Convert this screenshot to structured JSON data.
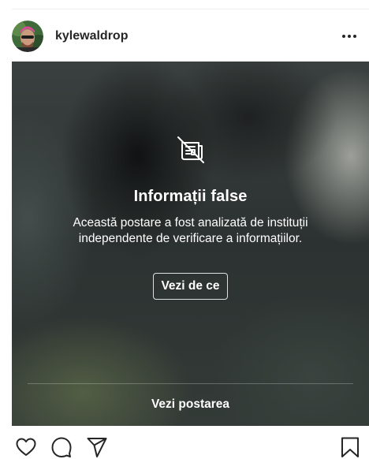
{
  "post": {
    "username": "kylewaldrop",
    "avatar_icon": "profile-photo",
    "more_icon": "more-options-icon"
  },
  "overlay": {
    "icon": "hidden-content-icon",
    "title": "Informații false",
    "description": "Această postare a fost analizată de instituții independente de verificare a informațiilor.",
    "see_why_label": "Vezi de ce",
    "see_post_label": "Vezi postarea"
  },
  "actions": {
    "like_icon": "heart-icon",
    "comment_icon": "comment-icon",
    "share_icon": "send-icon",
    "save_icon": "bookmark-icon"
  },
  "colors": {
    "text": "#262626",
    "overlay_text": "#ffffff",
    "divider": "#efefef"
  }
}
